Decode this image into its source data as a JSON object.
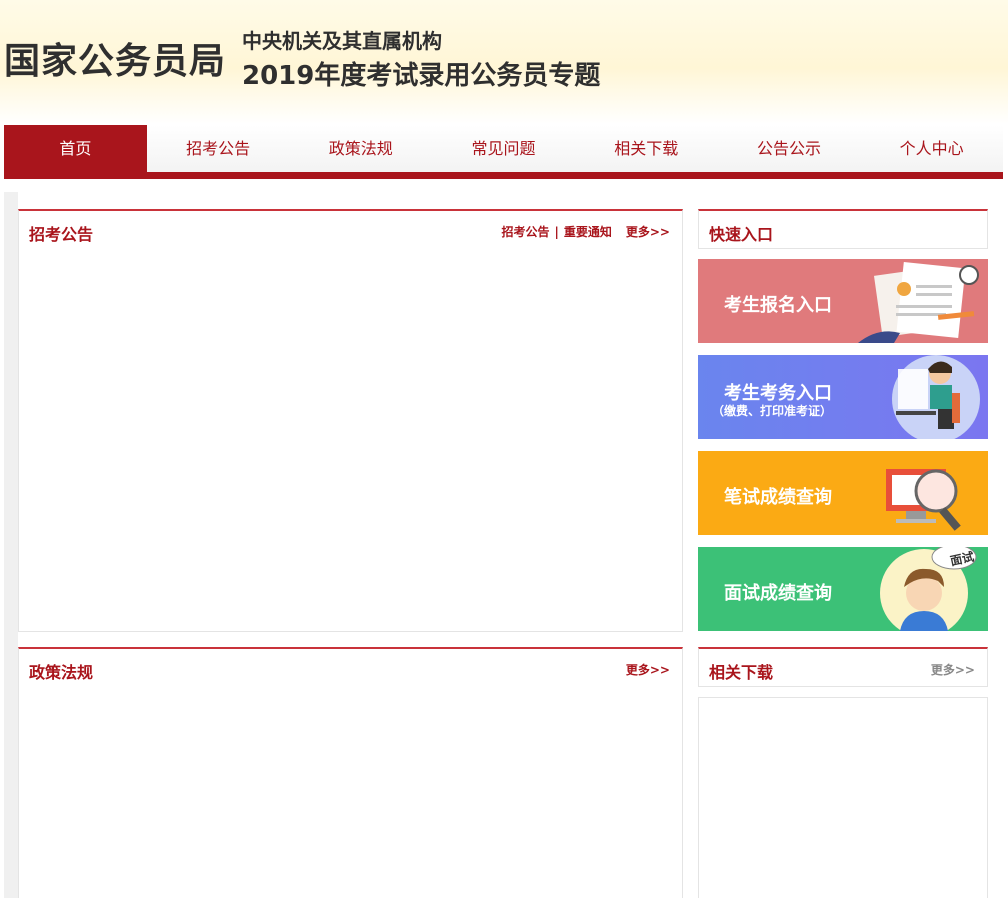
{
  "header": {
    "brand": "国家公务员局",
    "subtitle_line1": "中央机关及其直属机构",
    "subtitle_line2": "2019年度考试录用公务员专题"
  },
  "nav": {
    "items": [
      {
        "label": "首页",
        "active": true
      },
      {
        "label": "招考公告",
        "active": false
      },
      {
        "label": "政策法规",
        "active": false
      },
      {
        "label": "常见问题",
        "active": false
      },
      {
        "label": "相关下载",
        "active": false
      },
      {
        "label": "公告公示",
        "active": false
      },
      {
        "label": "个人中心",
        "active": false
      }
    ]
  },
  "panels": {
    "announcements": {
      "title": "招考公告",
      "link1": "招考公告",
      "separator": "|",
      "link2": "重要通知",
      "more": "更多>>"
    },
    "policies": {
      "title": "政策法规",
      "more": "更多>>"
    },
    "quick_entry": {
      "title": "快速入口",
      "buttons": [
        {
          "label": "考生报名入口",
          "sublabel": "",
          "color": "#e07a7c"
        },
        {
          "label": "考生考务入口",
          "sublabel": "（缴费、打印准考证）",
          "color": "#6d7ff0"
        },
        {
          "label": "笔试成绩查询",
          "sublabel": "",
          "color": "#fbaa14"
        },
        {
          "label": "面试成绩查询",
          "sublabel": "",
          "color": "#3cc177"
        }
      ],
      "interview_badge": "面试"
    },
    "downloads": {
      "title": "相关下载",
      "more": "更多>>"
    }
  },
  "colors": {
    "accent": "#a9151c",
    "panel_top": "#c9333a"
  }
}
